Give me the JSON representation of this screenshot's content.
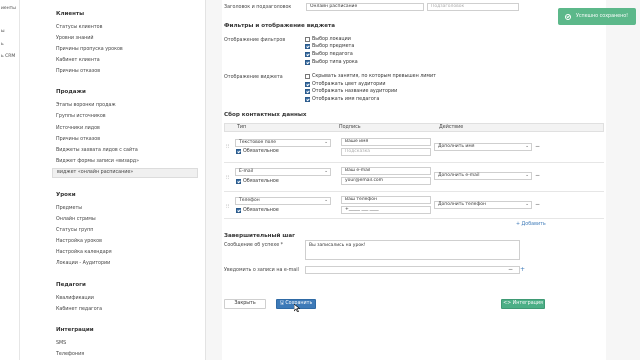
{
  "left_strip": [
    "иенты",
    "ы",
    "ь",
    "ь CRM"
  ],
  "sidebar": {
    "sections": [
      {
        "title": "Клиенты",
        "items": [
          "Статусы клиентов",
          "Уровни знаний",
          "Причины пропуска уроков",
          "Кабинет клиента",
          "Причины отказов"
        ]
      },
      {
        "title": "Продажи",
        "items": [
          "Этапы воронки продаж",
          "Группы источников",
          "Источники лидов",
          "Причины отказов",
          "Виджеты захвата лидов с сайта",
          "Виджет формы записи «визард»",
          "виджет «онлайн расписание»"
        ]
      },
      {
        "title": "Уроки",
        "items": [
          "Предметы",
          "Онлайн стримы",
          "Статусы групп",
          "Настройка уроков",
          "Настройка календаря",
          "Локации - Аудитории"
        ]
      },
      {
        "title": "Педагоги",
        "items": [
          "Квалификации",
          "Кабинет педагога"
        ]
      },
      {
        "title": "Интеграции",
        "items": [
          "SMS",
          "Телефония"
        ]
      }
    ],
    "active_item": "виджет «онлайн расписание»"
  },
  "top_row": {
    "label": "Заголовок и подзаголовок",
    "title_value": "Онлайн расписание",
    "subtitle_placeholder": "Подзаголовок"
  },
  "filters_section": {
    "heading": "Фильтры и отображение виджета",
    "filters_label": "Отображение фильтров",
    "filters": [
      {
        "label": "Выбор локации",
        "checked": false
      },
      {
        "label": "Выбор предмета",
        "checked": true
      },
      {
        "label": "Выбор педагога",
        "checked": true
      },
      {
        "label": "Выбор типа урока",
        "checked": true
      }
    ],
    "widget_label": "Отображение виджета",
    "widget_options": [
      {
        "label": "Скрывать занятия, по которым превышен лимит",
        "checked": false
      },
      {
        "label": "Отображать цвет аудитории",
        "checked": true
      },
      {
        "label": "Отображать название аудитории",
        "checked": true
      },
      {
        "label": "Отображать имя педагога",
        "checked": true
      }
    ]
  },
  "contacts": {
    "heading": "Сбор контактных данных",
    "columns": [
      "Тип",
      "Подпись",
      "Действие"
    ],
    "rows": [
      {
        "type": "Текстовое поле",
        "required_label": "Обязательное",
        "caption": "Ваше имя",
        "placeholder": "Подсказка",
        "action": "Дополнить имя"
      },
      {
        "type": "E-mail",
        "required_label": "Обязательное",
        "caption": "Ваш e-mail",
        "placeholder": "your@email.com",
        "action": "Дополнить e-mail"
      },
      {
        "type": "Телефон",
        "required_label": "Обязательное",
        "caption": "Ваш телефон",
        "placeholder": "+_____ ___ ____",
        "action": "Дополнить телефон"
      }
    ],
    "add_label": "Добавить"
  },
  "final_step": {
    "heading": "Завершительный шаг",
    "success_label": "Сообщение об успехе *",
    "success_value": "Вы записались на урок!",
    "notify_label": "Уведомить о записи на e-mail"
  },
  "buttons": {
    "close": "Закрыть",
    "save": "Сохранить",
    "integration": "<> Интеграция"
  },
  "toast": {
    "text": "Успешно сохранено!"
  },
  "colors": {
    "primary": "#3d7ab8",
    "success": "#5cb88a",
    "integration": "#4caf86"
  }
}
